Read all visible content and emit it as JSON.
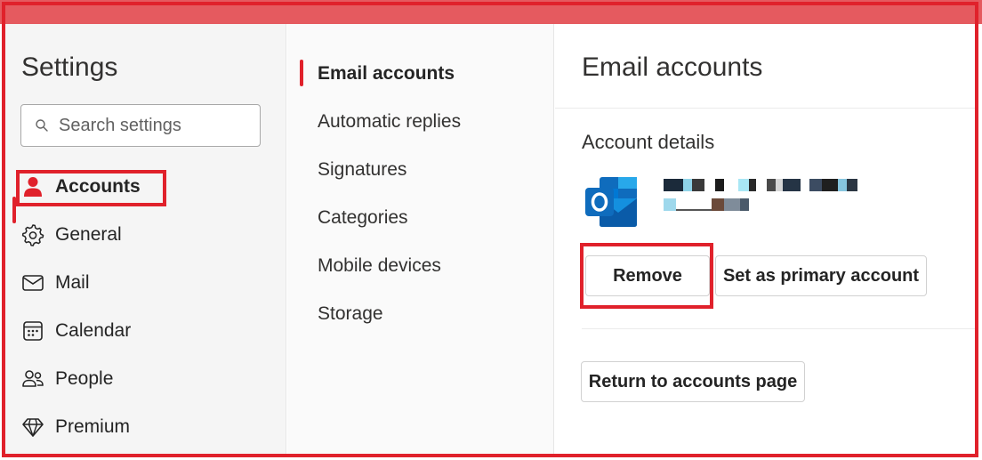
{
  "left_nav": {
    "title": "Settings",
    "search": {
      "placeholder": "Search settings",
      "value": ""
    },
    "items": [
      {
        "label": "Accounts",
        "icon": "person-icon",
        "selected": true
      },
      {
        "label": "General",
        "icon": "gear-icon"
      },
      {
        "label": "Mail",
        "icon": "mail-icon"
      },
      {
        "label": "Calendar",
        "icon": "calendar-icon"
      },
      {
        "label": "People",
        "icon": "people-icon"
      },
      {
        "label": "Premium",
        "icon": "diamond-icon"
      }
    ]
  },
  "sub_nav": {
    "items": [
      {
        "label": "Email accounts",
        "selected": true
      },
      {
        "label": "Automatic replies"
      },
      {
        "label": "Signatures"
      },
      {
        "label": "Categories"
      },
      {
        "label": "Mobile devices"
      },
      {
        "label": "Storage"
      }
    ]
  },
  "content": {
    "title": "Email accounts",
    "section_title": "Account details",
    "account_icon": "outlook-logo-icon",
    "buttons": {
      "remove": "Remove",
      "set_primary": "Set as primary account",
      "return": "Return to accounts page"
    }
  },
  "colors": {
    "accent_red": "#e0212b",
    "top_strip": "#e55a5f",
    "outlook_blue": "#0f6cbd"
  }
}
